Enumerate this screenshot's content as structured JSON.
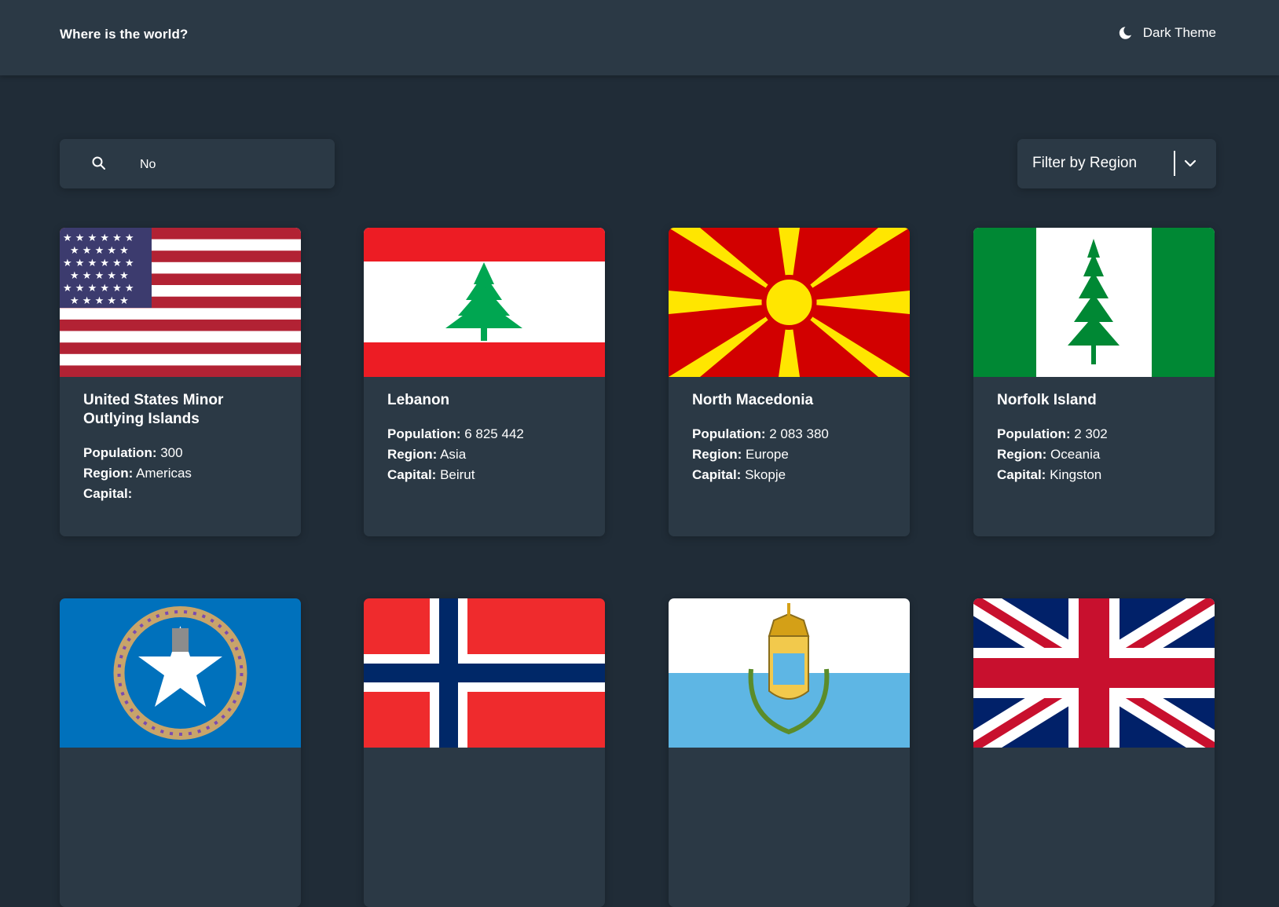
{
  "header": {
    "title": "Where is the world?",
    "theme_label": "Dark Theme"
  },
  "search": {
    "value": "No",
    "placeholder": "Search for a country..."
  },
  "filter": {
    "label": "Filter by Region"
  },
  "field_labels": {
    "population": "Population:",
    "region": "Region:",
    "capital": "Capital:"
  },
  "countries": [
    {
      "name": "United States Minor Outlying Islands",
      "population": "300",
      "region": "Americas",
      "capital": "",
      "flag": "usa"
    },
    {
      "name": "Lebanon",
      "population": "6 825 442",
      "region": "Asia",
      "capital": "Beirut",
      "flag": "lebanon"
    },
    {
      "name": "North Macedonia",
      "population": "2 083 380",
      "region": "Europe",
      "capital": "Skopje",
      "flag": "north-macedonia"
    },
    {
      "name": "Norfolk Island",
      "population": "2 302",
      "region": "Oceania",
      "capital": "Kingston",
      "flag": "norfolk-island"
    },
    {
      "flag": "northern-mariana-islands"
    },
    {
      "flag": "norway"
    },
    {
      "flag": "san-marino"
    },
    {
      "flag": "united-kingdom"
    }
  ],
  "colors": {
    "background": "#202c37",
    "surface": "#2b3945",
    "text": "#ffffff"
  }
}
